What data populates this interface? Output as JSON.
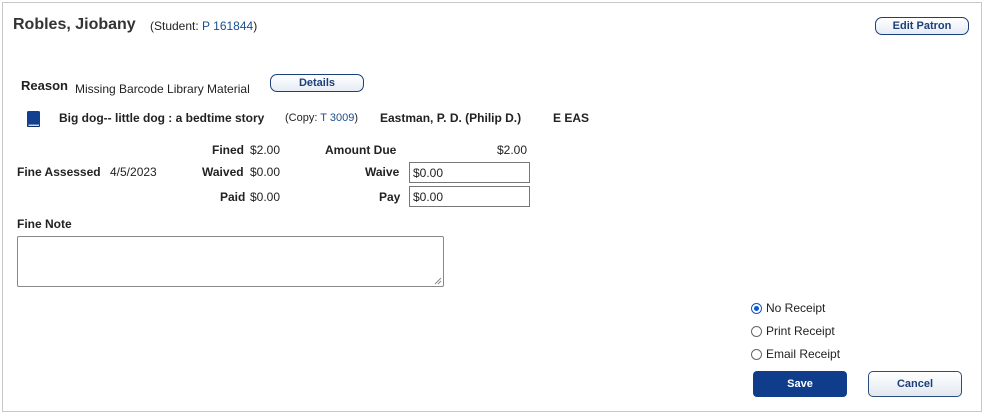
{
  "patron": {
    "name": "Robles, Jiobany",
    "student_prefix": "(Student: ",
    "student_id": "P 161844",
    "student_suffix": ")",
    "edit_button": "Edit Patron"
  },
  "reason": {
    "label": "Reason",
    "value": "Missing Barcode Library Material",
    "details_button": "Details"
  },
  "item": {
    "icon": "book-icon",
    "title": "Big dog-- little dog : a bedtime story",
    "copy_prefix": "(Copy: ",
    "copy_id": "T 3009",
    "copy_suffix": ")",
    "author": "Eastman, P. D. (Philip D.)",
    "call_number": "E EAS"
  },
  "fine": {
    "assessed_label": "Fine Assessed",
    "assessed_date": "4/5/2023",
    "fined_label": "Fined",
    "fined_value": "$2.00",
    "waived_label": "Waived",
    "waived_value": "$0.00",
    "paid_label": "Paid",
    "paid_value": "$0.00",
    "amount_due_label": "Amount Due",
    "amount_due_value": "$2.00",
    "waive_label": "Waive",
    "waive_input": "$0.00",
    "pay_label": "Pay",
    "pay_input": "$0.00"
  },
  "note": {
    "label": "Fine Note",
    "value": ""
  },
  "receipt": {
    "options": [
      "No Receipt",
      "Print Receipt",
      "Email Receipt"
    ],
    "selected": "No Receipt"
  },
  "actions": {
    "save": "Save",
    "cancel": "Cancel"
  },
  "colors": {
    "primary": "#0f3d8c",
    "link": "#1a4f8b"
  }
}
